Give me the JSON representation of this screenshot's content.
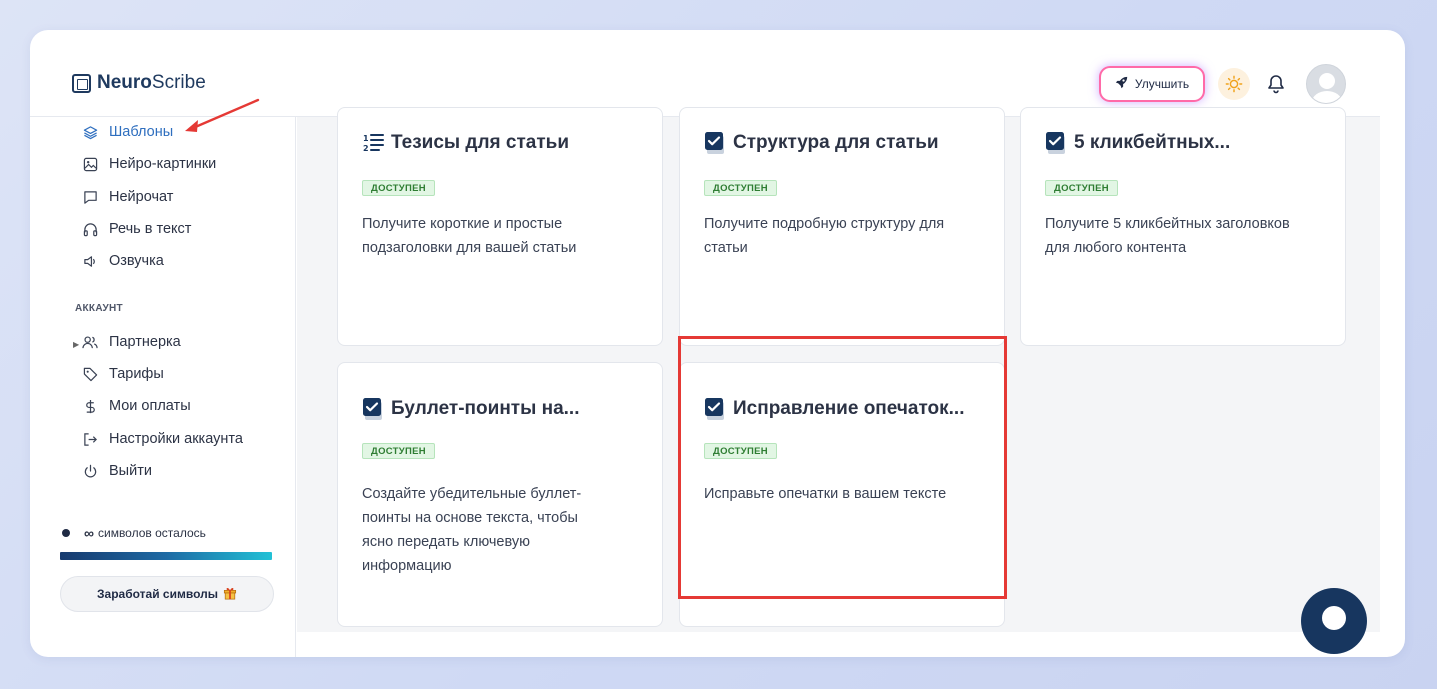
{
  "app": {
    "name_bold": "Neuro",
    "name_light": "Scribe"
  },
  "header": {
    "upgrade_label": "Улучшить"
  },
  "sidebar": {
    "items": [
      {
        "label": "Шаблоны",
        "icon": "layers-icon",
        "active": true
      },
      {
        "label": "Нейро-картинки",
        "icon": "image-icon"
      },
      {
        "label": "Нейрочат",
        "icon": "chat-icon"
      },
      {
        "label": "Речь в текст",
        "icon": "headphones-icon"
      },
      {
        "label": "Озвучка",
        "icon": "speaker-icon"
      }
    ],
    "account_section": "АККАУНТ",
    "account_items": [
      {
        "label": "Партнерка",
        "icon": "users-icon"
      },
      {
        "label": "Тарифы",
        "icon": "tag-icon"
      },
      {
        "label": "Мои оплаты",
        "icon": "dollar-icon"
      },
      {
        "label": "Настройки аккаунта",
        "icon": "login-icon"
      },
      {
        "label": "Выйти",
        "icon": "power-icon"
      }
    ],
    "credits": {
      "value": "∞",
      "label": "символов осталось"
    },
    "earn_label": "Заработай символы"
  },
  "cards": [
    {
      "title": "Тезисы для статьи",
      "icon": "numbered-list-icon",
      "badge": "ДОСТУПЕН",
      "desc": "Получите короткие и простые подзаголовки для вашей статьи"
    },
    {
      "title": "Структура для статьи",
      "icon": "checkbox-icon",
      "badge": "ДОСТУПЕН",
      "desc": "Получите подробную структуру для статьи"
    },
    {
      "title": "5 кликбейтных...",
      "icon": "checkbox-icon",
      "badge": "ДОСТУПЕН",
      "desc": "Получите 5 кликбейтных заголовков для любого контента"
    },
    {
      "title": "Буллет-поинты на...",
      "icon": "checkbox-icon",
      "badge": "ДОСТУПЕН",
      "desc": "Создайте убедительные буллет-поинты на основе текста, чтобы ясно передать ключевую информацию"
    },
    {
      "title": "Исправление опечаток...",
      "icon": "checkbox-icon",
      "badge": "ДОСТУПЕН",
      "desc": "Исправьте опечатки в вашем тексте"
    }
  ],
  "colors": {
    "accent": "#2f6fbf",
    "highlight": "#e53935",
    "badge_green": "#2e7d32",
    "brand_dark": "#17365f"
  }
}
